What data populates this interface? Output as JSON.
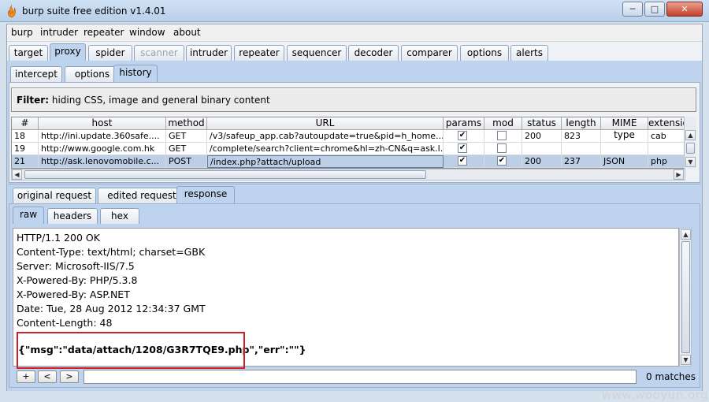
{
  "window": {
    "title": "burp suite free edition v1.4.01"
  },
  "titlebar_buttons": {
    "minimize": "─",
    "maximize": "□",
    "close": "✕"
  },
  "menu": [
    "burp",
    "intruder",
    "repeater",
    "window",
    "about"
  ],
  "main_tabs": [
    "target",
    "proxy",
    "spider",
    "scanner",
    "intruder",
    "repeater",
    "sequencer",
    "decoder",
    "comparer",
    "options",
    "alerts"
  ],
  "proxy_tabs": [
    "intercept",
    "options",
    "history"
  ],
  "filter": {
    "label": "Filter:",
    "text": "hiding CSS, image and general binary content"
  },
  "table": {
    "headers": [
      "#",
      "host",
      "method",
      "URL",
      "params",
      "mod",
      "status",
      "length",
      "MIME type",
      "extension"
    ],
    "rows": [
      {
        "num": "18",
        "host": "http://ini.update.360safe....",
        "method": "GET",
        "url": "/v3/safeup_app.cab?autoupdate=true&pid=h_home...",
        "params": true,
        "mod": false,
        "status": "200",
        "length": "823",
        "mime": "",
        "ext": "cab"
      },
      {
        "num": "19",
        "host": "http://www.google.com.hk",
        "method": "GET",
        "url": "/complete/search?client=chrome&hl=zh-CN&q=ask.l...",
        "params": true,
        "mod": false,
        "status": "",
        "length": "",
        "mime": "",
        "ext": ""
      },
      {
        "num": "21",
        "host": "http://ask.lenovomobile.c...",
        "method": "POST",
        "url": "/index.php?attach/upload",
        "params": true,
        "mod": true,
        "status": "200",
        "length": "237",
        "mime": "JSON",
        "ext": "php"
      }
    ],
    "selected_row": "21"
  },
  "request_tabs": [
    "original request",
    "edited request",
    "response"
  ],
  "view_tabs": [
    "raw",
    "headers",
    "hex"
  ],
  "response": {
    "lines": [
      "HTTP/1.1 200 OK",
      "Content-Type: text/html; charset=GBK",
      "Server: Microsoft-IIS/7.5",
      "X-Powered-By: PHP/5.3.8",
      "X-Powered-By: ASP.NET",
      "Date: Tue, 28 Aug 2012 12:34:37 GMT",
      "Content-Length: 48"
    ],
    "body_highlight": "{\"msg\":\"data/attach/1208/G3R7TQE9.php\"",
    "body_rest": ",\"err\":\"\"}"
  },
  "bottom": {
    "plus": "+",
    "prev": "<",
    "next": ">",
    "search_value": "",
    "matches": "0 matches"
  },
  "scroll_arrows": {
    "up": "▲",
    "down": "▼",
    "left": "◀",
    "right": "▶"
  },
  "checkmark": "✔",
  "watermark": "www.wooyun.org",
  "colors": {
    "selected_tab": "#bed3ee",
    "highlight_box": "#d21d2a",
    "selected_row": "#bccfe6"
  },
  "icons": {
    "app": "burp-flame-icon"
  }
}
